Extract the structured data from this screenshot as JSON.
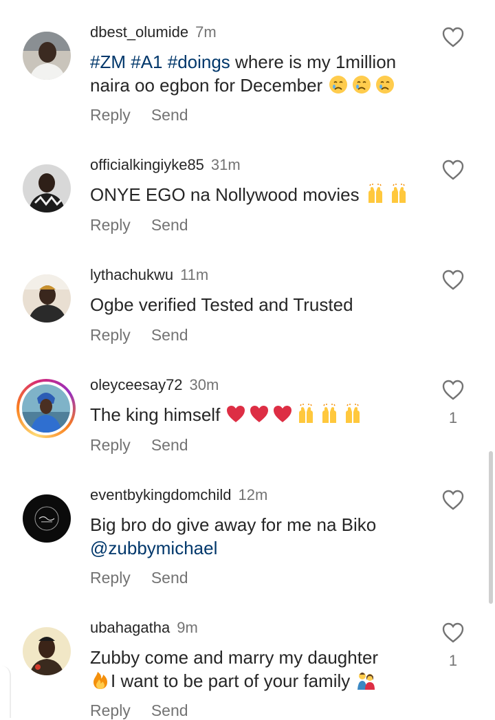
{
  "comments": [
    {
      "username": "dbest_olumide",
      "time": "7m",
      "tags": [
        "#ZM",
        "#A1",
        "#doings"
      ],
      "text_line1": "where is my 1million",
      "text_line2": "naira oo egbon for December",
      "emojis": [
        "crying-face",
        "crying-face",
        "crying-face"
      ],
      "reply_label": "Reply",
      "send_label": "Send",
      "likes": ""
    },
    {
      "username": "officialkingiyke85",
      "time": "31m",
      "text_line1": "ONYE EGO na Nollywood movies",
      "emojis": [
        "raising-hands",
        "raising-hands"
      ],
      "reply_label": "Reply",
      "send_label": "Send",
      "likes": ""
    },
    {
      "username": "lythachukwu",
      "time": "11m",
      "text_line1": "Ogbe verified Tested and Trusted",
      "reply_label": "Reply",
      "send_label": "Send",
      "likes": ""
    },
    {
      "username": "oleyceesay72",
      "time": "30m",
      "text_line1": "The king himself",
      "emojis": [
        "red-heart",
        "red-heart",
        "red-heart",
        "raising-hands",
        "raising-hands",
        "raising-hands"
      ],
      "reply_label": "Reply",
      "send_label": "Send",
      "likes": "1"
    },
    {
      "username": "eventbykingdomchild",
      "time": "12m",
      "text_line1": "Big bro do give away for me na Biko",
      "mention": "@zubbymichael",
      "reply_label": "Reply",
      "send_label": "Send",
      "likes": ""
    },
    {
      "username": "ubahagatha",
      "time": "9m",
      "text_line1": "Zubby come and marry my daughter",
      "text_line2": "I want to be part of your family",
      "emojis": [
        "fire",
        "family"
      ],
      "reply_label": "Reply",
      "send_label": "Send",
      "likes": "1"
    }
  ],
  "colors": {
    "text": "#262626",
    "secondary": "#737373",
    "hashtag": "#00376b"
  }
}
